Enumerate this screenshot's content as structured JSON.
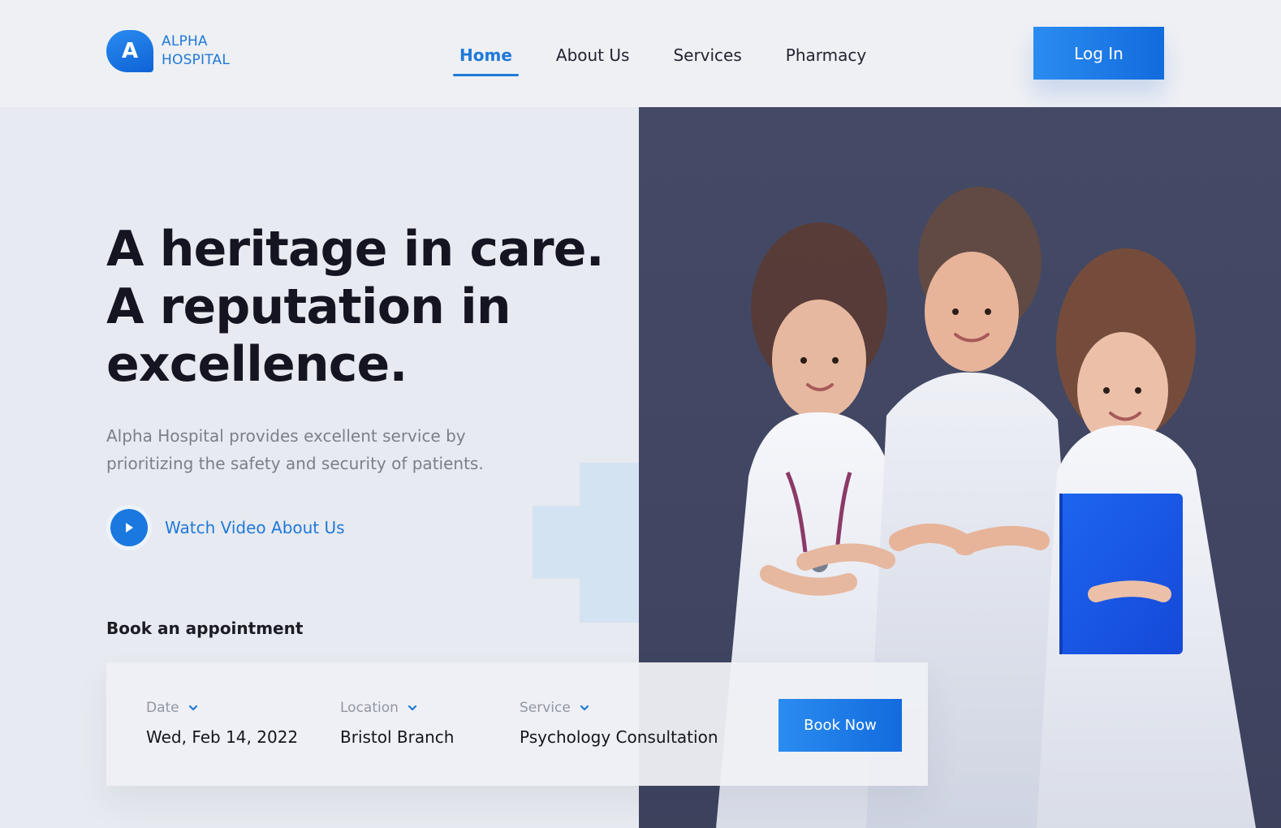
{
  "brand": {
    "logo_letter": "A",
    "line1": "ALPHA",
    "line2": "HOSPITAL"
  },
  "nav": {
    "items": [
      {
        "label": "Home",
        "active": true
      },
      {
        "label": "About Us",
        "active": false
      },
      {
        "label": "Services",
        "active": false
      },
      {
        "label": "Pharmacy",
        "active": false
      }
    ],
    "login_label": "Log In"
  },
  "hero": {
    "title_lines": [
      "A heritage in care.",
      "A reputation in",
      "excellence."
    ],
    "description": "Alpha Hospital provides excellent service by prioritizing the safety and security of patients.",
    "watch_label": "Watch Video About Us"
  },
  "booking": {
    "title": "Book an appointment",
    "fields": [
      {
        "label": "Date",
        "value": "Wed, Feb 14, 2022"
      },
      {
        "label": "Location",
        "value": "Bristol Branch"
      },
      {
        "label": "Service",
        "value": "Psychology Consultation"
      }
    ],
    "book_now_label": "Book Now"
  },
  "icons": {
    "play": "play-icon",
    "chevron": "chevron-down-icon"
  },
  "colors": {
    "accent": "#1f79d8",
    "accent_dark": "#136bdd",
    "hero_bg": "#e7eaf0",
    "photo_bg": "#444a65",
    "text_dark": "#151521"
  }
}
